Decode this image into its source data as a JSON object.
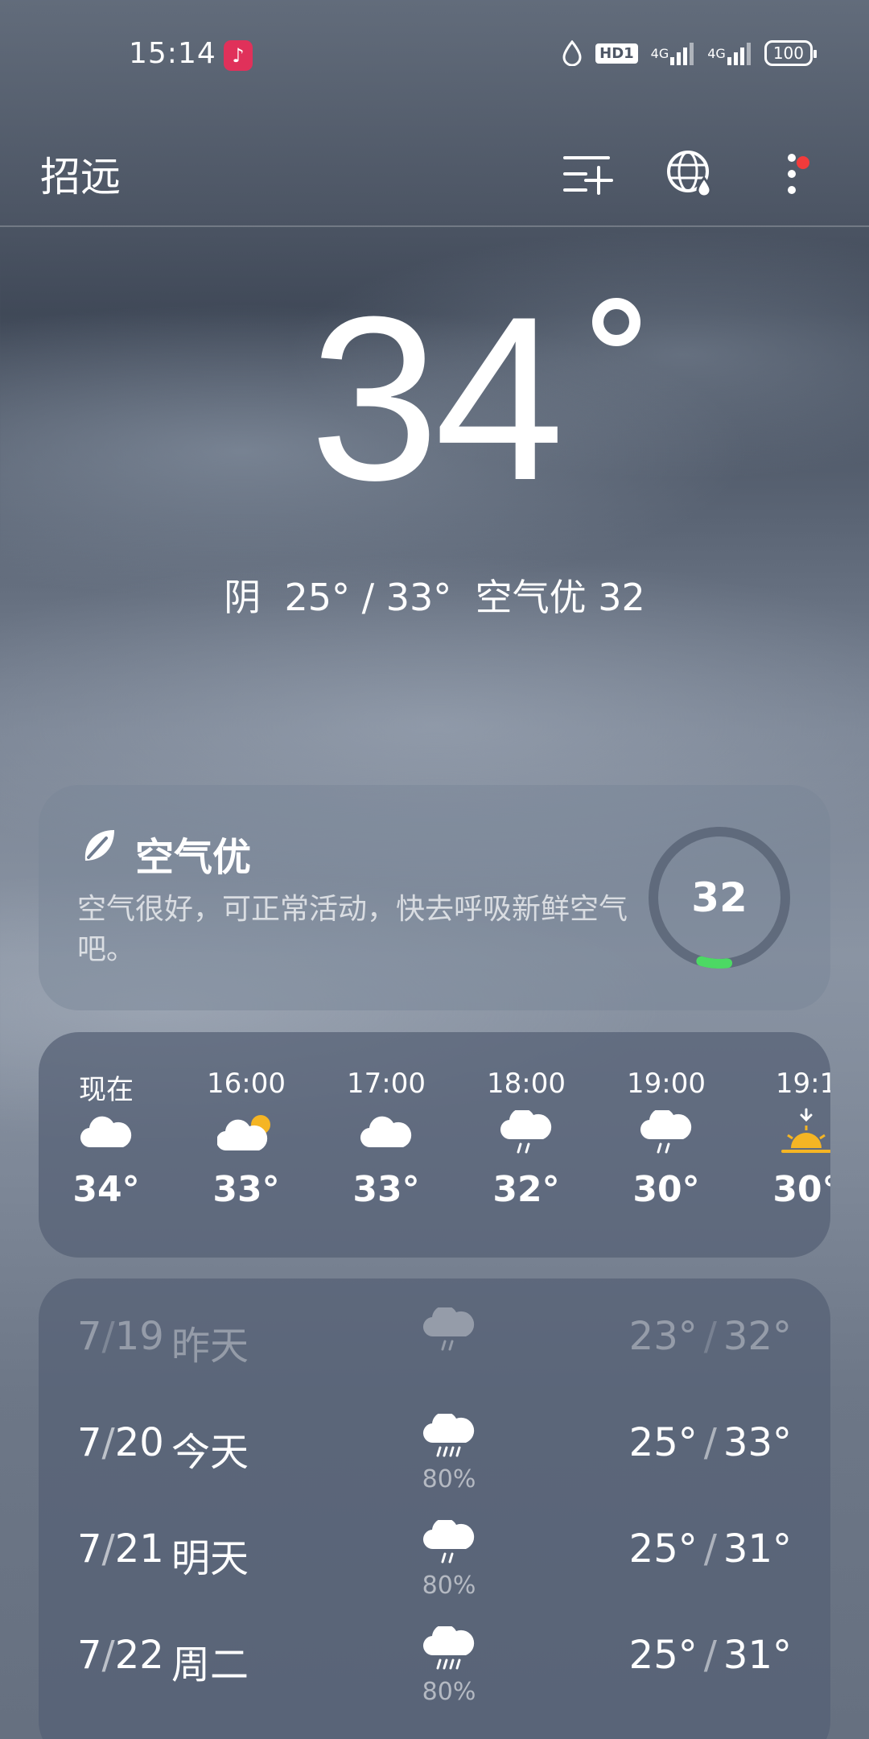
{
  "status_bar": {
    "time": "15:14",
    "music_icon": "music-note-icon",
    "hd_label": "HD1",
    "signal1_label": "4G",
    "signal2_label": "4G",
    "battery": "100"
  },
  "header": {
    "city": "招远",
    "icons": [
      "add-city-icon",
      "globe-rain-icon",
      "more-vertical-icon"
    ]
  },
  "current": {
    "temperature": "34",
    "condition": "阴",
    "range": "25° / 33°",
    "air_label": "空气优",
    "air_value": "32"
  },
  "aqi_card": {
    "title": "空气优",
    "description": "空气很好，可正常活动，快去呼吸新鲜空气吧。",
    "value": "32",
    "gauge_fraction": 0.064,
    "gauge_color": "#4cd964"
  },
  "hourly": [
    {
      "time": "现在",
      "icon": "cloud-icon",
      "temp": "34°"
    },
    {
      "time": "16:00",
      "icon": "cloud-sun-icon",
      "temp": "33°"
    },
    {
      "time": "17:00",
      "icon": "cloud-icon",
      "temp": "33°"
    },
    {
      "time": "18:00",
      "icon": "rain-icon",
      "temp": "32°"
    },
    {
      "time": "19:00",
      "icon": "rain-icon",
      "temp": "30°"
    },
    {
      "time": "19:1",
      "icon": "sunset-icon",
      "temp": "30°"
    }
  ],
  "daily": [
    {
      "month": "7",
      "day": "19",
      "name": "昨天",
      "icon": "rain-icon",
      "pop": "",
      "low": "23°",
      "high": "32°"
    },
    {
      "month": "7",
      "day": "20",
      "name": "今天",
      "icon": "heavy-rain-icon",
      "pop": "80%",
      "low": "25°",
      "high": "33°"
    },
    {
      "month": "7",
      "day": "21",
      "name": "明天",
      "icon": "rain-icon",
      "pop": "80%",
      "low": "25°",
      "high": "31°"
    },
    {
      "month": "7",
      "day": "22",
      "name": "周二",
      "icon": "heavy-rain-icon",
      "pop": "80%",
      "low": "25°",
      "high": "31°"
    }
  ],
  "colors": {
    "accent_sun": "#f5b524",
    "notification_dot": "#f23b3b"
  }
}
